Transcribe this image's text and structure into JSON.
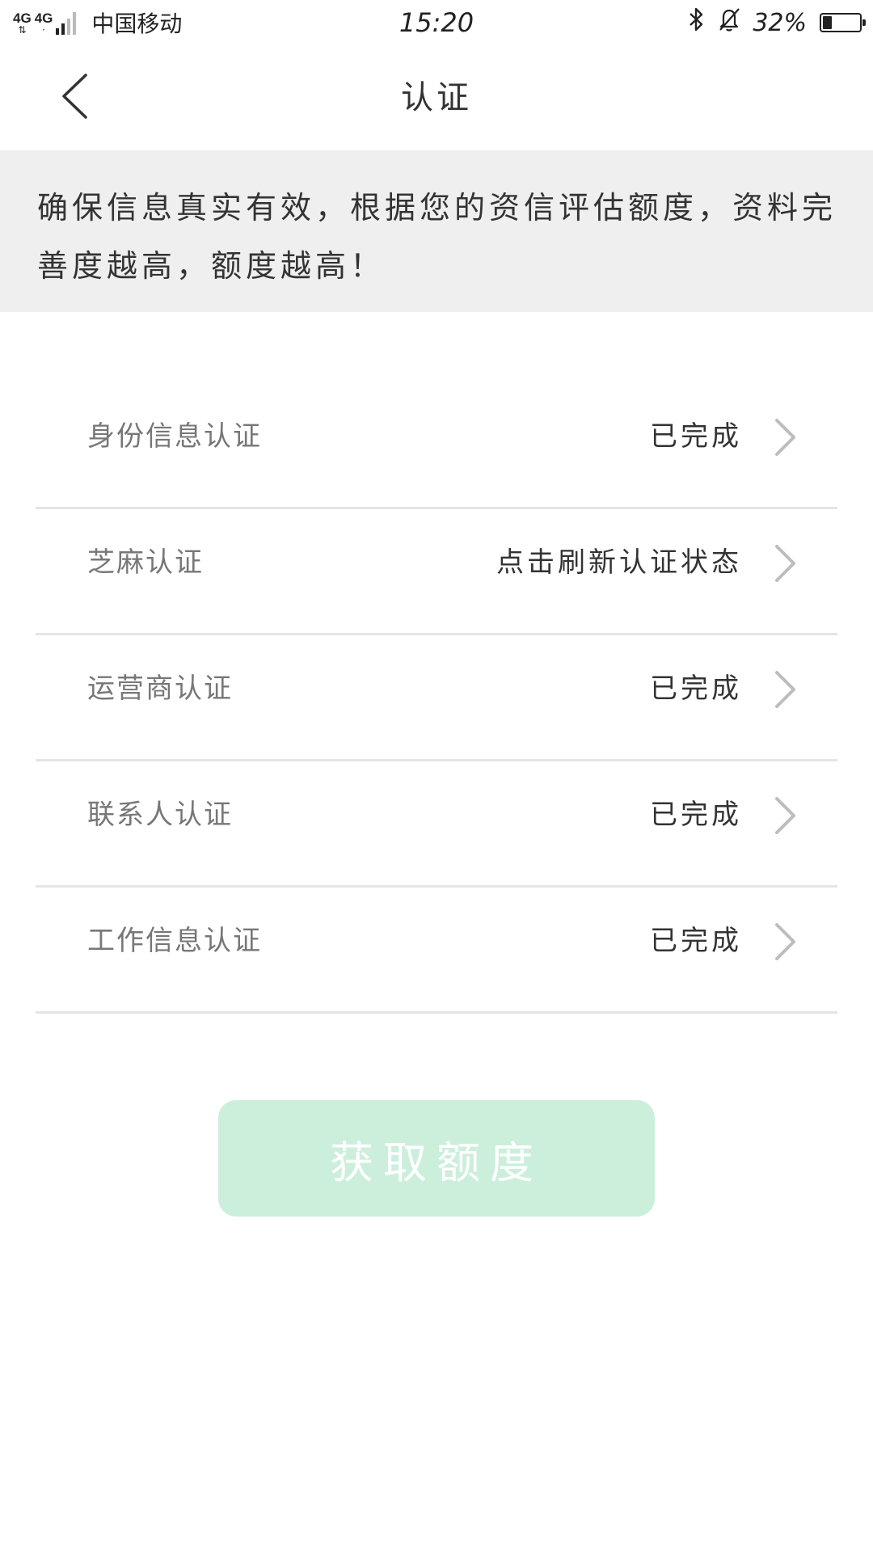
{
  "status_bar": {
    "network_1": "4G",
    "network_2": "4G",
    "carrier": "中国移动",
    "time": "15:20",
    "bluetooth_icon": "bluetooth-icon",
    "bell_icon": "bell-off-icon",
    "battery_percent": "32%",
    "battery_level": 0.32
  },
  "nav": {
    "back_icon": "chevron-left-icon",
    "title": "认证"
  },
  "notice": {
    "text": "确保信息真实有效，根据您的资信评估额度，资料完善度越高，额度越高！"
  },
  "certifications": [
    {
      "label": "身份信息认证",
      "status": "已完成"
    },
    {
      "label": "芝麻认证",
      "status": "点击刷新认证状态"
    },
    {
      "label": "运营商认证",
      "status": "已完成"
    },
    {
      "label": "联系人认证",
      "status": "已完成"
    },
    {
      "label": "工作信息认证",
      "status": "已完成"
    }
  ],
  "action": {
    "get_limit_label": "获取额度"
  },
  "colors": {
    "notice_background": "#efefef",
    "button_background": "#ccefdc",
    "button_text": "#ffffff",
    "divider": "#e5e5e5",
    "chevron": "#bdbdbd"
  }
}
